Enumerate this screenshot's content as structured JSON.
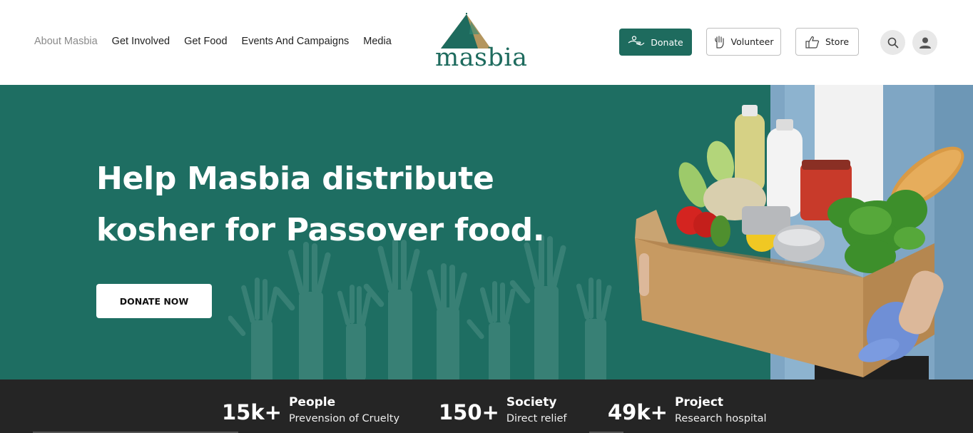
{
  "nav": {
    "items": [
      "About Masbia",
      "Get Involved",
      "Get Food",
      "Events And Campaigns",
      "Media"
    ]
  },
  "logo": {
    "text": "masbia"
  },
  "header_buttons": {
    "donate": "Donate",
    "volunteer": "Volunteer",
    "store": "Store"
  },
  "icons": {
    "search": "search-icon",
    "user": "user-icon",
    "donate": "hand-coin-icon",
    "volunteer": "raised-hand-icon",
    "store": "thumbs-up-icon"
  },
  "hero": {
    "title_line1": "Help Masbia distribute",
    "title_line2": "kosher for Passover food.",
    "cta": "DONATE NOW"
  },
  "stats": [
    {
      "number": "15k+",
      "label": "People",
      "sub": "Prevension of Cruelty"
    },
    {
      "number": "150+",
      "label": "Society",
      "sub": "Direct relief"
    },
    {
      "number": "49k+",
      "label": "Project",
      "sub": "Research hospital"
    }
  ],
  "colors": {
    "brand_green": "#1e6e62",
    "logo_tan": "#b4965e",
    "stats_bg": "#252525"
  }
}
